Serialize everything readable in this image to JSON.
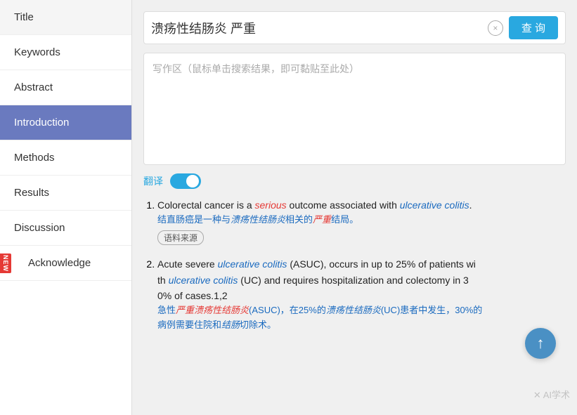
{
  "sidebar": {
    "items": [
      {
        "id": "title",
        "label": "Title",
        "active": false
      },
      {
        "id": "keywords",
        "label": "Keywords",
        "active": false
      },
      {
        "id": "abstract",
        "label": "Abstract",
        "active": false
      },
      {
        "id": "introduction",
        "label": "Introduction",
        "active": true
      },
      {
        "id": "methods",
        "label": "Methods",
        "active": false
      },
      {
        "id": "results",
        "label": "Results",
        "active": false
      },
      {
        "id": "discussion",
        "label": "Discussion",
        "active": false
      },
      {
        "id": "acknowledge",
        "label": "Acknowledge",
        "active": false,
        "new": true
      }
    ]
  },
  "search": {
    "value": "溃疡性结肠炎 严重",
    "placeholder": "写作区（鼠标单击搜索结果，即可黏贴至此处）",
    "clear_label": "×",
    "query_label": "查 询"
  },
  "translate": {
    "label": "翻译"
  },
  "results": [
    {
      "index": 1,
      "en_parts": [
        {
          "text": "Colorectal cancer is a ",
          "style": "normal"
        },
        {
          "text": "serious",
          "style": "italic-red"
        },
        {
          "text": " outcome associated with ",
          "style": "normal"
        },
        {
          "text": "ulcerative colitis",
          "style": "italic-blue"
        },
        {
          "text": ".",
          "style": "normal"
        }
      ],
      "zh_parts": [
        {
          "text": "结直肠癌是一种与",
          "style": "normal"
        },
        {
          "text": "溃疡性结肠炎",
          "style": "italic-blue"
        },
        {
          "text": "相关的",
          "style": "normal"
        },
        {
          "text": "严重",
          "style": "italic-red"
        },
        {
          "text": "结局。",
          "style": "normal"
        }
      ],
      "source_tag": "语料来源"
    },
    {
      "index": 2,
      "en_parts": [
        {
          "text": "Acute severe ",
          "style": "normal"
        },
        {
          "text": "ulcerative colitis",
          "style": "italic-blue"
        },
        {
          "text": " (ASUC), occurs in up to 25% of patients wi th ",
          "style": "normal"
        },
        {
          "text": "ulcerative colitis",
          "style": "italic-blue"
        },
        {
          "text": " (UC) and requires hospitalization and colectomy in 3 0% of cases.1,2",
          "style": "normal"
        }
      ],
      "zh_parts": [
        {
          "text": "急性",
          "style": "normal"
        },
        {
          "text": "严重溃疡性结肠炎",
          "style": "italic-red"
        },
        {
          "text": "(ASUC)，在25%的",
          "style": "normal"
        },
        {
          "text": "溃疡性结肠炎",
          "style": "italic-blue"
        },
        {
          "text": "(UC)患者中发生，30%的 病例需要住院和",
          "style": "normal"
        },
        {
          "text": "结肠",
          "style": "italic-blue"
        },
        {
          "text": "切除术。",
          "style": "normal"
        }
      ]
    }
  ],
  "watermark": "✕ AI学术",
  "scroll_up_label": "↑"
}
